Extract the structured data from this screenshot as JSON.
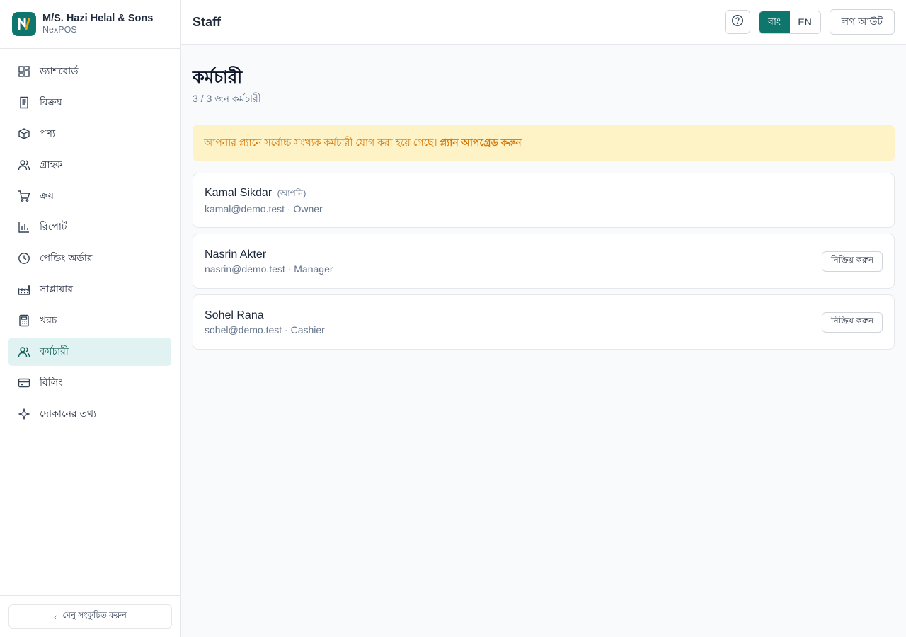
{
  "brand": {
    "name": "M/S. Hazi Helal & Sons",
    "product": "NexPOS"
  },
  "sidebar": {
    "items": [
      {
        "label": "ড্যাশবোর্ড",
        "icon": "dashboard-icon"
      },
      {
        "label": "বিক্রয়",
        "icon": "receipt-icon"
      },
      {
        "label": "পণ্য",
        "icon": "box-icon"
      },
      {
        "label": "গ্রাহক",
        "icon": "users-icon"
      },
      {
        "label": "ক্রয়",
        "icon": "cart-icon"
      },
      {
        "label": "রিপোর্ট",
        "icon": "bar-chart-icon"
      },
      {
        "label": "পেন্ডিং অর্ডার",
        "icon": "clock-icon"
      },
      {
        "label": "সাপ্লায়ার",
        "icon": "factory-icon"
      },
      {
        "label": "খরচ",
        "icon": "calculator-icon"
      },
      {
        "label": "কর্মচারী",
        "icon": "users-icon",
        "active": true
      },
      {
        "label": "বিলিং",
        "icon": "credit-card-icon"
      },
      {
        "label": "দোকানের তথ্য",
        "icon": "sparkle-icon"
      }
    ],
    "collapse_label": "মেনু সংকুচিত করুন"
  },
  "header": {
    "title": "Staff",
    "lang_bn": "বাং",
    "lang_en": "EN",
    "active_lang": "bn",
    "logout_label": "লগ আউট"
  },
  "main": {
    "title": "কর্মচারী",
    "subtitle": "3 / 3 জন কর্মচারী",
    "alert": {
      "text": "আপনার প্ল্যানে সর্বোচ্চ সংখ্যক কর্মচারী যোগ করা হয়ে গেছে।",
      "link": "প্ল্যান আপগ্রেড করুন"
    },
    "staff": [
      {
        "name": "Kamal Sikdar",
        "you_label": "(আপনি)",
        "meta": "kamal@demo.test · Owner",
        "action": ""
      },
      {
        "name": "Nasrin Akter",
        "you_label": "",
        "meta": "nasrin@demo.test · Manager",
        "action": "নিষ্ক্রিয় করুন"
      },
      {
        "name": "Sohel Rana",
        "you_label": "",
        "meta": "sohel@demo.test · Cashier",
        "action": "নিষ্ক্রিয় করুন"
      }
    ]
  },
  "colors": {
    "accent": "#0f766e",
    "alert_bg": "#fef3c7",
    "alert_text": "#d97706"
  }
}
